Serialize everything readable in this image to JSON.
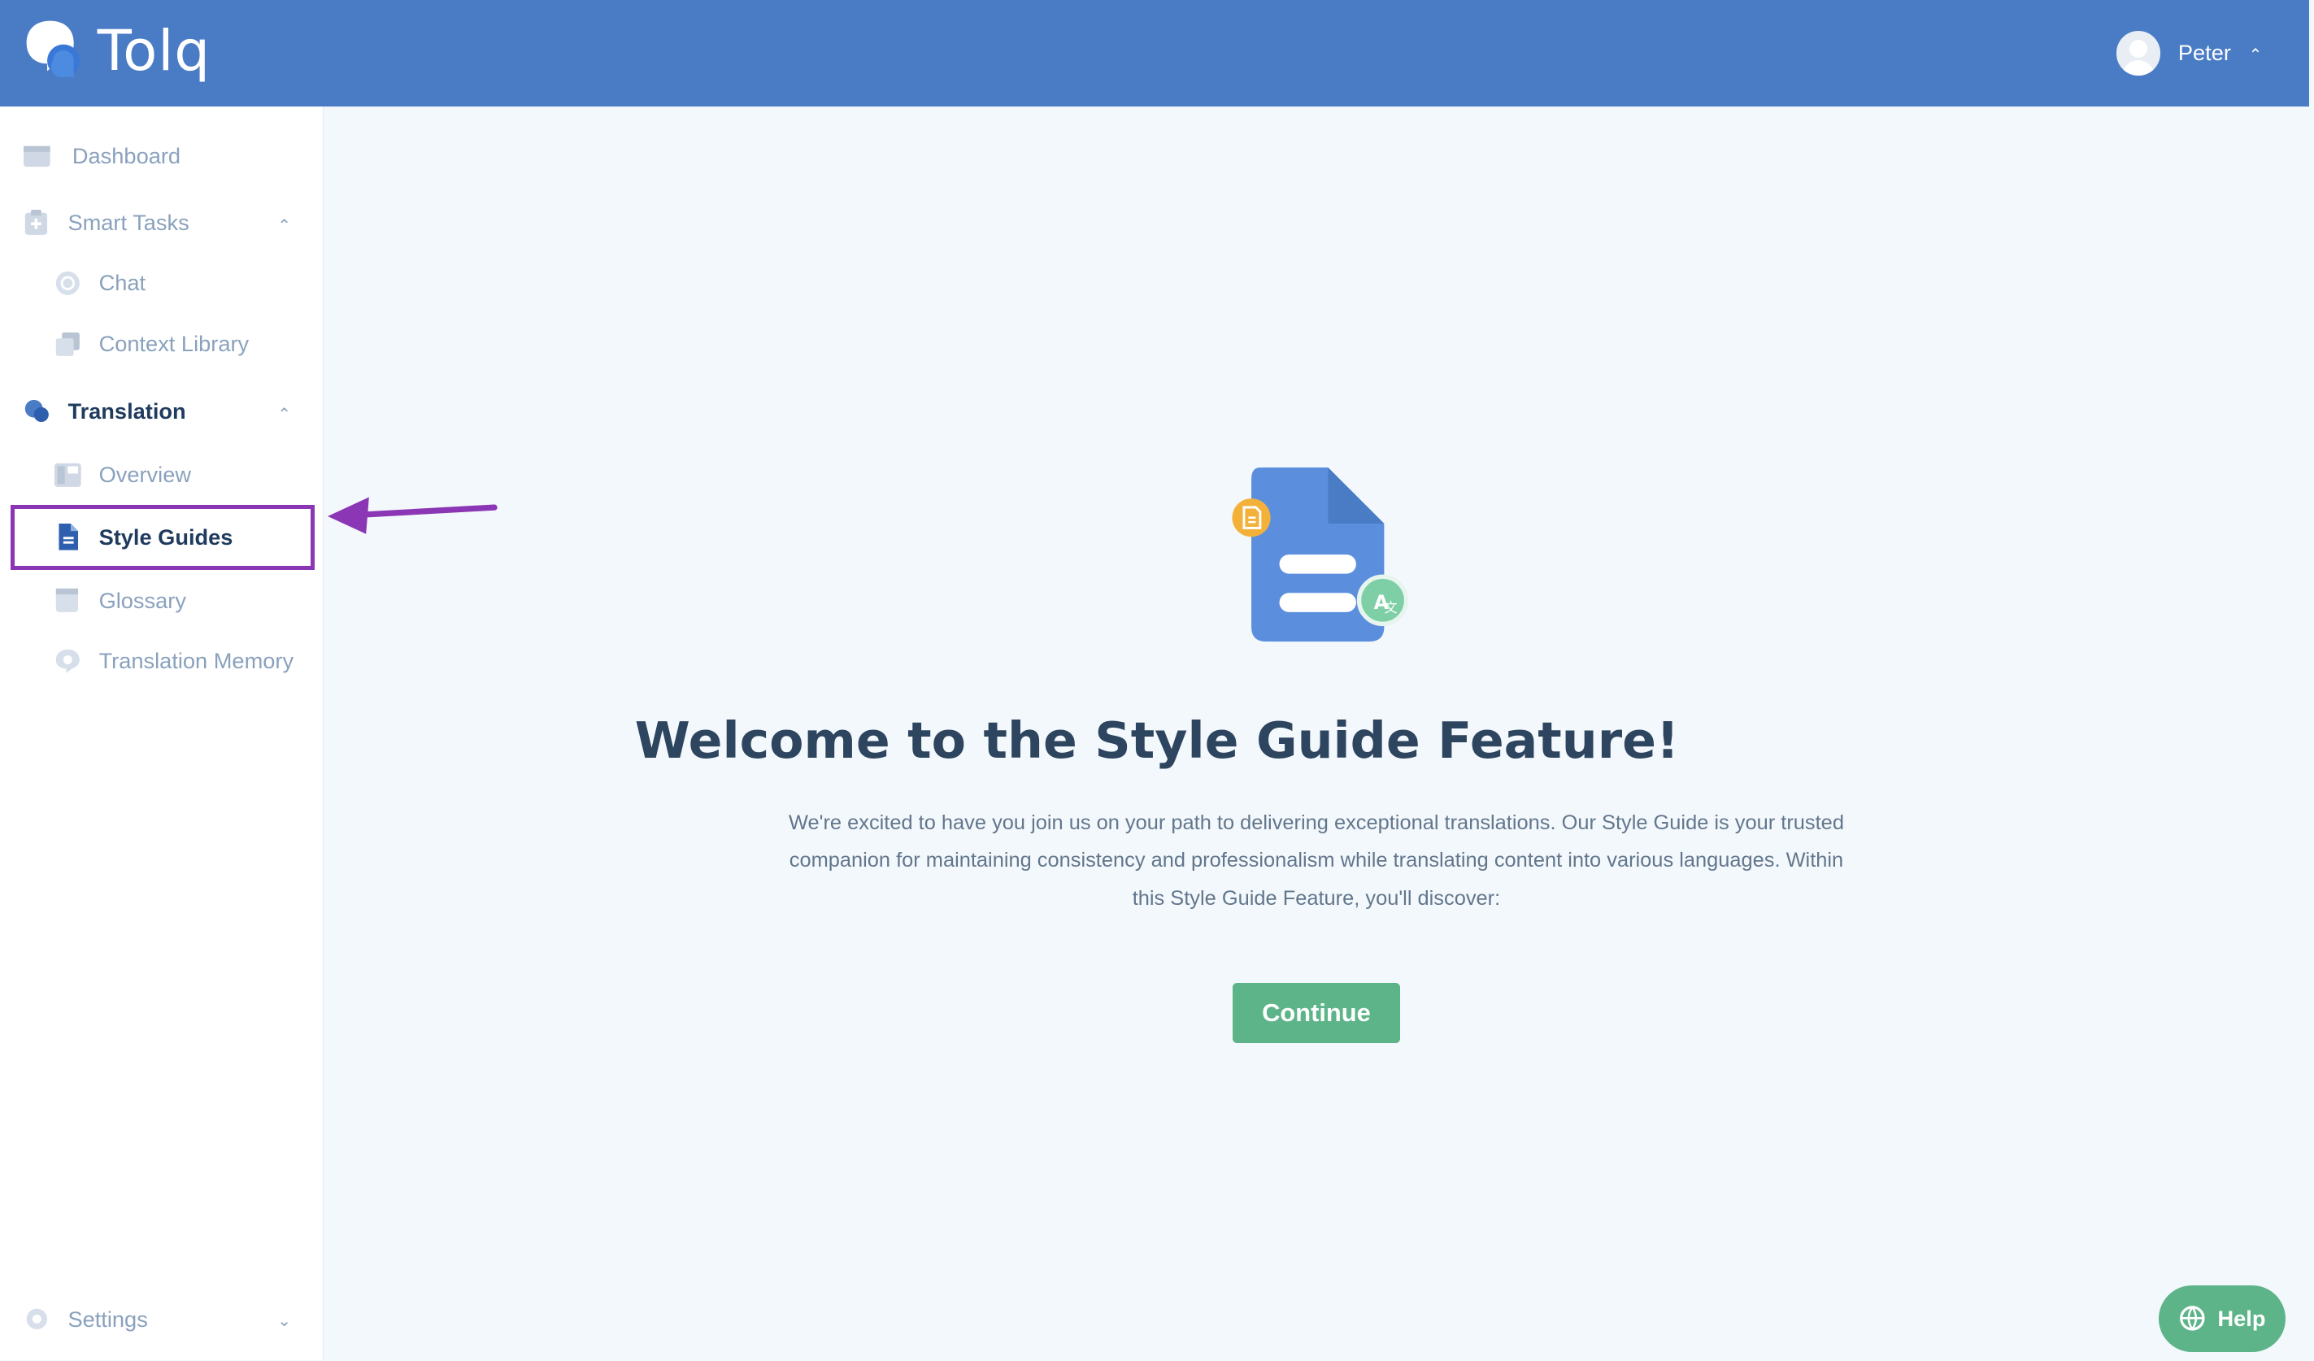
{
  "header": {
    "brand": "Tolq",
    "user_name": "Peter"
  },
  "sidebar": {
    "dashboard": "Dashboard",
    "smart_tasks": "Smart Tasks",
    "chat": "Chat",
    "context_library": "Context Library",
    "translation": "Translation",
    "overview": "Overview",
    "style_guides": "Style Guides",
    "glossary": "Glossary",
    "translation_memory": "Translation Memory",
    "settings": "Settings"
  },
  "main": {
    "title": "Welcome to the Style Guide Feature!",
    "description": "We're excited to have you join us on your path to delivering exceptional translations. Our Style Guide is your trusted companion for maintaining consistency and professionalism while translating content into various languages. Within this Style Guide Feature, you'll discover:",
    "continue_label": "Continue",
    "help_label": "Help"
  },
  "colors": {
    "header_bg": "#4a7cc6",
    "accent_green": "#5db489",
    "highlight_purple": "#8b36b5"
  }
}
